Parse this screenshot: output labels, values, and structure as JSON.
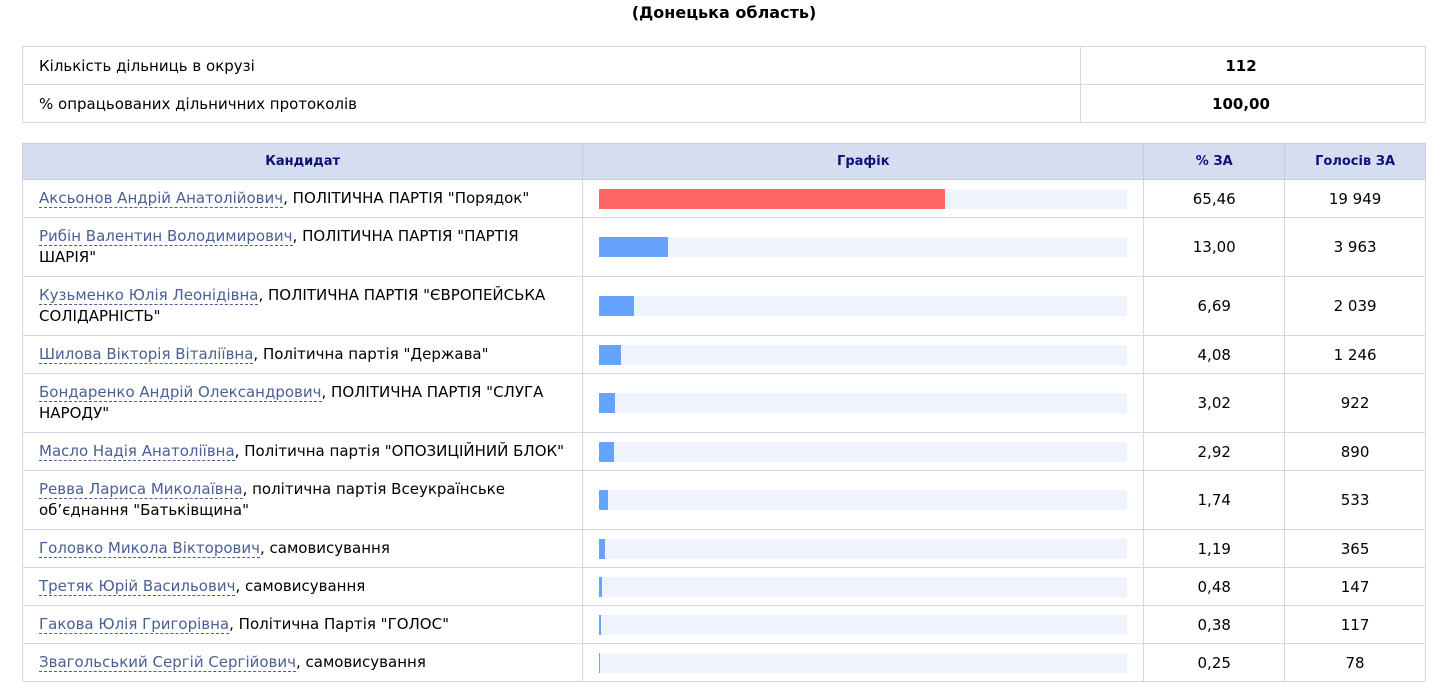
{
  "region_title": "(Донецька область)",
  "summary": [
    {
      "label": "Кількість дільниць в окрузі",
      "value": "112"
    },
    {
      "label": "% опрацьованих дільничних протоколів",
      "value": "100,00"
    }
  ],
  "headers": {
    "candidate": "Кандидат",
    "chart": "Графік",
    "percent": "% ЗА",
    "votes": "Голосів ЗА"
  },
  "colors": {
    "leader": "#fe6565",
    "others": "#66a3ff",
    "track": "#eef3fd",
    "header_bg": "#d5def1",
    "link": "#4a5f93"
  },
  "chart_data": {
    "type": "bar",
    "orientation": "horizontal",
    "ylim": [
      0,
      100
    ],
    "series": [
      {
        "values": [
          65.46,
          13.0,
          6.69,
          4.08,
          3.02,
          2.92,
          1.74,
          1.19,
          0.48,
          0.38,
          0.25
        ]
      }
    ]
  },
  "rows": [
    {
      "name": "Аксьонов Андрій Анатолійович",
      "party": ", ПОЛІТИЧНА ПАРТІЯ \"Порядок\"",
      "percent_text": "65,46",
      "votes": "19 949",
      "pct": 65.46,
      "leader": true
    },
    {
      "name": "Рибін Валентин Володимирович",
      "party": ", ПОЛІТИЧНА ПАРТІЯ \"ПАРТІЯ ШАРІЯ\"",
      "percent_text": "13,00",
      "votes": "3 963",
      "pct": 13.0,
      "leader": false
    },
    {
      "name": "Кузьменко Юлія Леонідівна",
      "party": ", ПОЛІТИЧНА ПАРТІЯ \"ЄВРОПЕЙСЬКА СОЛІДАРНІСТЬ\"",
      "percent_text": "6,69",
      "votes": "2 039",
      "pct": 6.69,
      "leader": false
    },
    {
      "name": "Шилова Вікторія Віталіївна",
      "party": ", Політична партія \"Держава\"",
      "percent_text": "4,08",
      "votes": "1 246",
      "pct": 4.08,
      "leader": false
    },
    {
      "name": "Бондаренко Андрій Олександрович",
      "party": ", ПОЛІТИЧНА ПАРТІЯ \"СЛУГА НАРОДУ\"",
      "percent_text": "3,02",
      "votes": "922",
      "pct": 3.02,
      "leader": false
    },
    {
      "name": "Масло Надія Анатоліївна",
      "party": ", Політична партія \"ОПОЗИЦІЙНИЙ БЛОК\"",
      "percent_text": "2,92",
      "votes": "890",
      "pct": 2.92,
      "leader": false
    },
    {
      "name": "Ревва Лариса Миколаївна",
      "party": ", політична партія Всеукраїнське об’єднання \"Батьківщина\"",
      "percent_text": "1,74",
      "votes": "533",
      "pct": 1.74,
      "leader": false
    },
    {
      "name": "Головко Микола Вікторович",
      "party": ", самовисування",
      "percent_text": "1,19",
      "votes": "365",
      "pct": 1.19,
      "leader": false
    },
    {
      "name": "Третяк Юрій Васильович",
      "party": ", самовисування",
      "percent_text": "0,48",
      "votes": "147",
      "pct": 0.48,
      "leader": false
    },
    {
      "name": "Гакова Юлія Григорівна",
      "party": ", Політична Партія \"ГОЛОС\"",
      "percent_text": "0,38",
      "votes": "117",
      "pct": 0.38,
      "leader": false
    },
    {
      "name": "Звагольський Сергій Сергійович",
      "party": ", самовисування",
      "percent_text": "0,25",
      "votes": "78",
      "pct": 0.25,
      "leader": false
    }
  ]
}
